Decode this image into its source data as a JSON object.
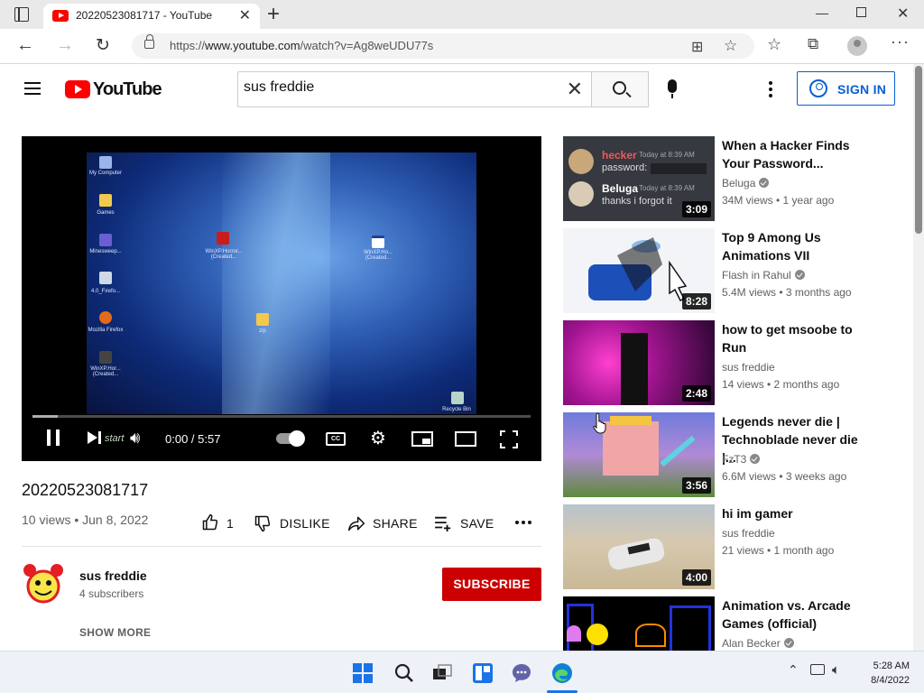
{
  "browser": {
    "tab_title": "20220523081717 - YouTube",
    "url_prefix": "https://",
    "url_host": "www.youtube.com",
    "url_path": "/watch?v=Ag8weUDU77s"
  },
  "header": {
    "logo_text": "YouTube",
    "search_value": "sus freddie",
    "signin_label": "SIGN IN"
  },
  "player": {
    "start_label": "start",
    "timecode": "0:00 / 5:57",
    "desktop_icons": [
      {
        "label": "My Computer"
      },
      {
        "label": "Games"
      },
      {
        "label": "Minesweep..."
      },
      {
        "label": "4.0_Firefo..."
      },
      {
        "label": "Mozilla Firefox"
      },
      {
        "label": "WinXP.Hor... (Created..."
      },
      {
        "label": "WinXP.Horror... (Created..."
      },
      {
        "label": "WinXP.Ho... (Created..."
      },
      {
        "label": "zip"
      },
      {
        "label": "Recycle Bin"
      }
    ]
  },
  "video": {
    "title": "20220523081717",
    "meta": "10 views • Jun 8, 2022",
    "likes": "1",
    "dislike_label": "DISLIKE",
    "share_label": "SHARE",
    "save_label": "SAVE"
  },
  "channel": {
    "name": "sus freddie",
    "subscribers": "4 subscribers",
    "subscribe_label": "SUBSCRIBE",
    "show_more": "SHOW MORE"
  },
  "recommendations": [
    {
      "title": "When a Hacker Finds Your Password...",
      "channel": "Beluga",
      "verified": true,
      "meta": "34M views • 1 year ago",
      "duration": "3:09",
      "chat": {
        "user1": "hecker",
        "time1": "Today at 8:39 AM",
        "msg1": "password:",
        "user2": "Beluga",
        "time2": "Today at 8:39 AM",
        "msg2": "thanks i forgot it"
      }
    },
    {
      "title": "Top 9 Among Us Animations VII",
      "channel": "Flash in Rahul",
      "verified": true,
      "meta": "5.4M views • 3 months ago",
      "duration": "8:28"
    },
    {
      "title": "how to get msoobe to Run",
      "channel": "sus freddie",
      "verified": false,
      "meta": "14 views • 2 months ago",
      "duration": "2:48"
    },
    {
      "title": "Legends never die | Technoblade never die |...",
      "channel": "FzT3",
      "verified": true,
      "meta": "6.6M views • 3 weeks ago",
      "duration": "3:56"
    },
    {
      "title": "hi im gamer",
      "channel": "sus freddie",
      "verified": false,
      "meta": "21 views • 1 month ago",
      "duration": "4:00"
    },
    {
      "title": "Animation vs. Arcade Games (official)",
      "channel": "Alan Becker",
      "verified": true,
      "meta": "",
      "duration": ""
    }
  ],
  "taskbar": {
    "time": "5:28 AM",
    "date": "8/4/2022"
  },
  "colors": {
    "brand_red": "#ff0000",
    "subscribe_red": "#cc0000",
    "link_blue": "#065fd4"
  }
}
